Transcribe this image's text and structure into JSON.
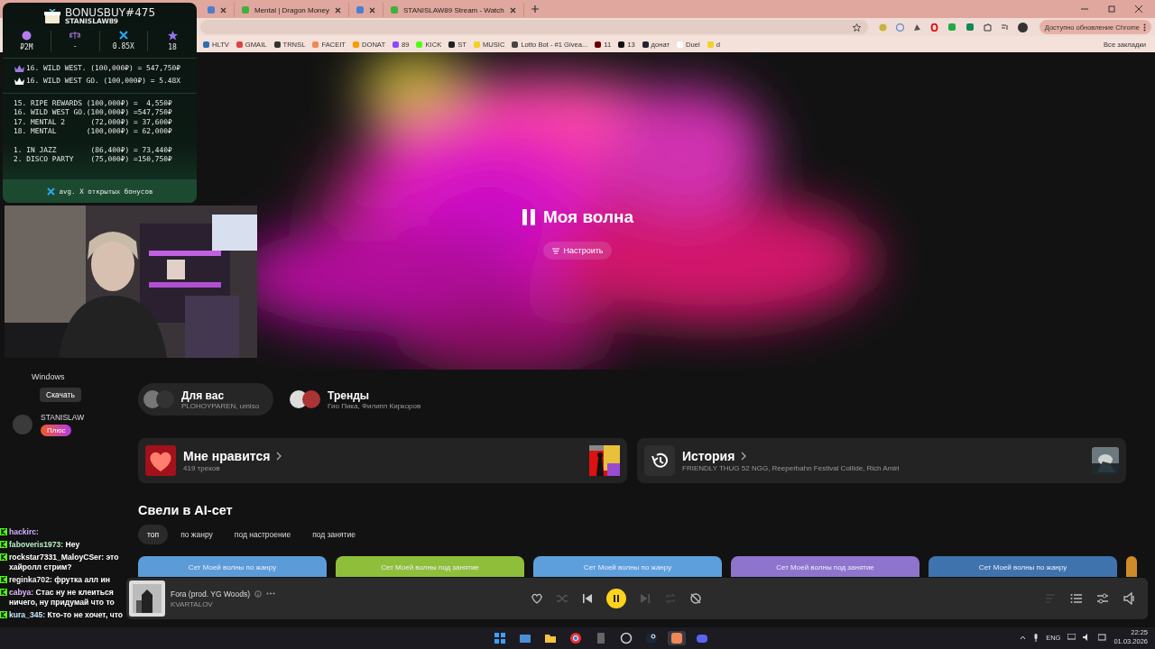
{
  "browser": {
    "tabs": [
      {
        "kind": "icon"
      },
      {
        "kind": "titled",
        "title": "Mental | Dragon Money"
      },
      {
        "kind": "icon"
      },
      {
        "kind": "titled",
        "title": "STANISLAW89 Stream - Watch"
      }
    ],
    "bookmarks": [
      "HLTV",
      "GMAIL",
      "TRNSL",
      "FACEIT",
      "DONAT",
      "89",
      "KICK",
      "ST",
      "MUSIC",
      "Lotto Bot - #1 Givea...",
      "11",
      "13",
      "донат",
      "Duel",
      "d"
    ],
    "all_bookmarks": "Все закладки",
    "update_button": "Доступно обновление Chrome"
  },
  "stream_overlay": {
    "title": "BONUSBUY#475",
    "streamer": "STANISLAW89",
    "stats": [
      {
        "kind": "coin",
        "value": "₽2M"
      },
      {
        "kind": "scales",
        "value": "-"
      },
      {
        "kind": "cross",
        "value": "0.85X"
      },
      {
        "kind": "star",
        "value": "18"
      }
    ],
    "best": [
      {
        "kind": "top",
        "text": "16. WILD WEST. (100,000₽) = 547,750₽"
      },
      {
        "kind": "best_x",
        "text": "16. WILD WEST GO. (100,000₽) = 5.48X"
      }
    ],
    "bonuses": [
      {
        "name": "15. RIPE REWARDS",
        "bet": "(100,000₽) =",
        "result": "4,550₽"
      },
      {
        "name": "16. WILD WEST GO.",
        "bet": "(100,000₽) =",
        "result": "547,750₽"
      },
      {
        "name": "17. MENTAL 2",
        "bet": "(72,000₽) =",
        "result": "37,600₽"
      },
      {
        "name": "18. MENTAL",
        "bet": "(100,000₽) =",
        "result": "62,000₽"
      },
      {
        "name": "1. IN JAZZ",
        "bet": "(86,400₽) =",
        "result": "73,440₽"
      },
      {
        "name": "2. DISCO PARTY",
        "bet": "(75,000₽) =",
        "result": "150,750₽"
      }
    ],
    "footer": "avg. X открытых бонусов"
  },
  "sidebar": {
    "notice_title": "Windows",
    "notice_button": "Скачать",
    "profile_name": "STANISLAW",
    "plus_badge": "Плюс"
  },
  "hero": {
    "title": "Моя волна",
    "playing": true,
    "tune_button": "Настроить"
  },
  "quick": [
    {
      "title": "Для вас",
      "subtitle": "PLOHOYPAREN, umiso",
      "selected": true
    },
    {
      "title": "Тренды",
      "subtitle": "Гио Пика, Филипп Киркоров",
      "selected": false
    }
  ],
  "cards": [
    {
      "kind": "likes",
      "title": "Мне нравится",
      "subtitle": "419 треков"
    },
    {
      "kind": "history",
      "title": "История",
      "subtitle": "FRIENDLY THUG 52 NGG, Reeperbahn Festival Collide, Rich Amiri"
    }
  ],
  "section": {
    "title": "Свели в AI-сет",
    "filters": [
      {
        "label": "топ",
        "selected": true
      },
      {
        "label": "по жанру",
        "selected": false
      },
      {
        "label": "под настроение",
        "selected": false
      },
      {
        "label": "под занятие",
        "selected": false
      }
    ],
    "sets": [
      {
        "title": "Сет Моей волны по жанру",
        "color": "#5b9bd8"
      },
      {
        "title": "Сет Моей волны под занятие",
        "color": "#8fbf3a"
      },
      {
        "title": "Сет Моей волны по жанру",
        "color": "#5d9fdc"
      },
      {
        "title": "Сет Моей волны под занятие",
        "color": "#8e74cc"
      },
      {
        "title": "Сет Моей волны по жанру",
        "color": "#3f73ad"
      },
      {
        "color": "#d08a2a"
      }
    ]
  },
  "player": {
    "title": "Fora (prod. YG Woods)",
    "artist": "KVARTALOV",
    "playing": true,
    "liked": false
  },
  "chat": [
    {
      "user": "hackirc:",
      "color": "#d0b0ff"
    },
    {
      "user": "faboveris1973:",
      "text": "Hey",
      "color": "#b8f0c8"
    },
    {
      "user": "rockstar7331_MaloyCSer:",
      "text": "это хайролл стрим?",
      "color": "#ffffff"
    },
    {
      "user": "reginka702:",
      "text": "фрутка алл ин",
      "color": "#f0f0f0"
    },
    {
      "user": "cabya:",
      "text": "Стас ну не клеиться ничего, ну придумай что то",
      "color": "#e0b8ff"
    },
    {
      "user": "kura_345:",
      "text": "Кто-то не хочет, что",
      "color": "#c8e8ff"
    }
  ],
  "taskbar": {
    "language": "ENG",
    "time": "22:25",
    "date": "01.03.2026"
  }
}
